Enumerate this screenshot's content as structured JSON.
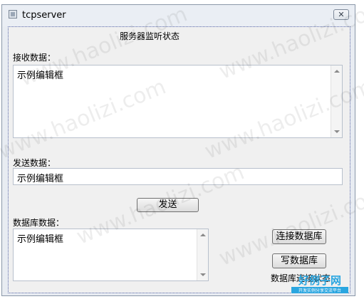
{
  "window": {
    "title": "tcpserver",
    "close_glyph": "✕"
  },
  "status": {
    "title": "服务器监听状态"
  },
  "receive": {
    "label": "接收数据：",
    "content": "示例编辑框"
  },
  "send": {
    "label": "发送数据：",
    "content": "示例编辑框",
    "button_label": "发送"
  },
  "database": {
    "label": "数据库数据：",
    "content": "示例编辑框",
    "connect_button": "连接数据库",
    "write_button": "写数据库",
    "status_label": "数据库连接状态"
  },
  "watermark": "www.haolizi.com",
  "logo": {
    "text": "好例子网",
    "subtitle": "开发实例分享交流平台",
    "accent": "#2aa6e0"
  }
}
